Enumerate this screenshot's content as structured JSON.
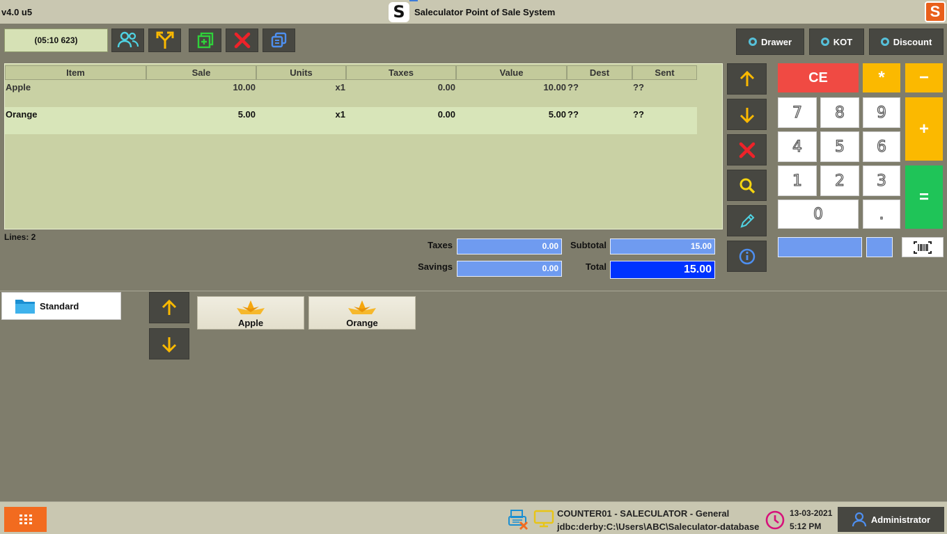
{
  "titlebar": {
    "version": "v4.0 u5",
    "logo_letter": "S",
    "title": "Saleculator Point of Sale System"
  },
  "toolbar": {
    "ticket_id": "(05:10 623)",
    "drawer_label": "Drawer",
    "kot_label": "KOT",
    "discount_label": "Discount"
  },
  "table": {
    "columns": [
      "Item",
      "Sale",
      "Units",
      "Taxes",
      "Value",
      "Dest",
      "Sent"
    ],
    "rows": [
      {
        "item": "Apple",
        "sale": "10.00",
        "units": "x1",
        "taxes": "0.00",
        "value": "10.00",
        "dest": "??",
        "sent": "??"
      },
      {
        "item": "Orange",
        "sale": "5.00",
        "units": "x1",
        "taxes": "0.00",
        "value": "5.00",
        "dest": "??",
        "sent": "??"
      }
    ]
  },
  "summary": {
    "lines": "Lines: 2",
    "taxes_label": "Taxes",
    "taxes_value": "0.00",
    "savings_label": "Savings",
    "savings_value": "0.00",
    "subtotal_label": "Subtotal",
    "subtotal_value": "15.00",
    "total_label": "Total",
    "total_value": "15.00"
  },
  "keypad": {
    "ce": "CE",
    "multiply": "*",
    "minus": "−",
    "plus": "+",
    "equals": "=",
    "digits": [
      "7",
      "8",
      "9",
      "4",
      "5",
      "6",
      "1",
      "2",
      "3",
      "0",
      "."
    ]
  },
  "categories": {
    "items": [
      {
        "label": "Standard"
      }
    ]
  },
  "products": [
    {
      "label": "Apple"
    },
    {
      "label": "Orange"
    }
  ],
  "statusbar": {
    "line1": "COUNTER01 - SALECULATOR - General",
    "line2": "jdbc:derby:C:\\Users\\ABC\\Saleculator-database",
    "date": "13-03-2021",
    "time": "5:12 PM",
    "user": "Administrator"
  },
  "colors": {
    "accent_blue": "#0033ff",
    "ce_red": "#f04a43",
    "op_yellow": "#fbb900",
    "equals_green": "#1fc458",
    "menu_orange": "#f26b1f"
  }
}
